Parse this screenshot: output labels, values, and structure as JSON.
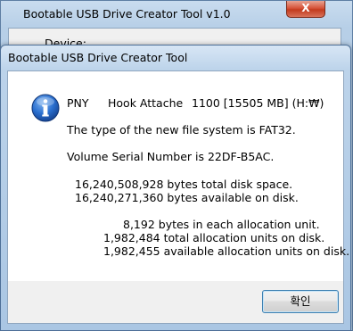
{
  "background_window": {
    "title": "Bootable USB Drive Creator Tool    v1.0",
    "close_label": "X",
    "device_label": "Device:"
  },
  "dialog": {
    "title": "Bootable USB Drive Creator Tool",
    "icon": "information-icon",
    "device_line": {
      "brand": "PNY",
      "model": "Hook Attache",
      "version_size": "1100 [15505 MB] (H:₩)"
    },
    "filesystem_line": "The type of the new file system is FAT32.",
    "serial_line": "Volume Serial Number is 22DF-B5AC.",
    "disk_space": {
      "total": "16,240,508,928 bytes total disk space.",
      "available": "16,240,271,360 bytes available on disk."
    },
    "allocation": {
      "unit_size": "8,192 bytes in each allocation unit.",
      "total_units": "1,982,484 total allocation units on disk.",
      "available_units": "1,982,455 available allocation units on disk."
    },
    "ok_label": "확인"
  },
  "colors": {
    "accent": "#3c7fb1",
    "close_button": "#c23b1e",
    "info_icon": "#1f5fb8"
  }
}
